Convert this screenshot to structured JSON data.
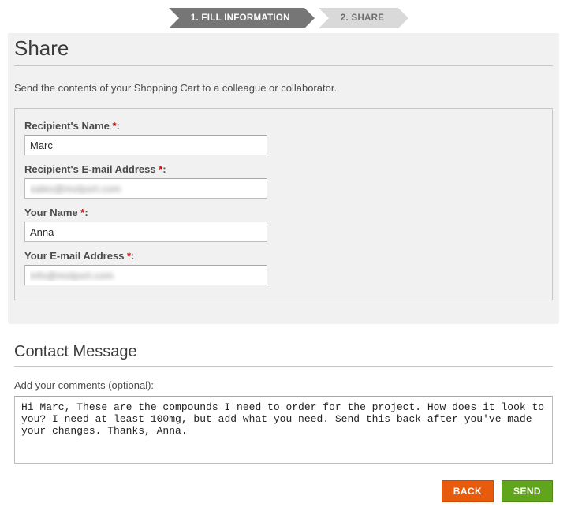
{
  "steps": {
    "step1": "1. FILL INFORMATION",
    "step2": "2. SHARE"
  },
  "header": {
    "title": "Share",
    "intro": "Send the contents of your Shopping Cart to a colleague or collaborator."
  },
  "form": {
    "recipient_name": {
      "label": "Recipient's Name",
      "required": "*",
      "value": "Marc"
    },
    "recipient_email": {
      "label": "Recipient's E-mail Address",
      "required": "*",
      "value": "sales@molport.com"
    },
    "your_name": {
      "label": "Your Name",
      "required": "*",
      "value": "Anna"
    },
    "your_email": {
      "label": "Your E-mail Address",
      "required": "*",
      "value": "info@molport.com"
    }
  },
  "message_section": {
    "title": "Contact Message",
    "hint": "Add your comments (optional):",
    "text": "Hi Marc, These are the compounds I need to order for the project. How does it look to you? I need at least 100mg, but add what you need. Send this back after you've made your changes. Thanks, Anna."
  },
  "buttons": {
    "back": "BACK",
    "send": "SEND"
  }
}
